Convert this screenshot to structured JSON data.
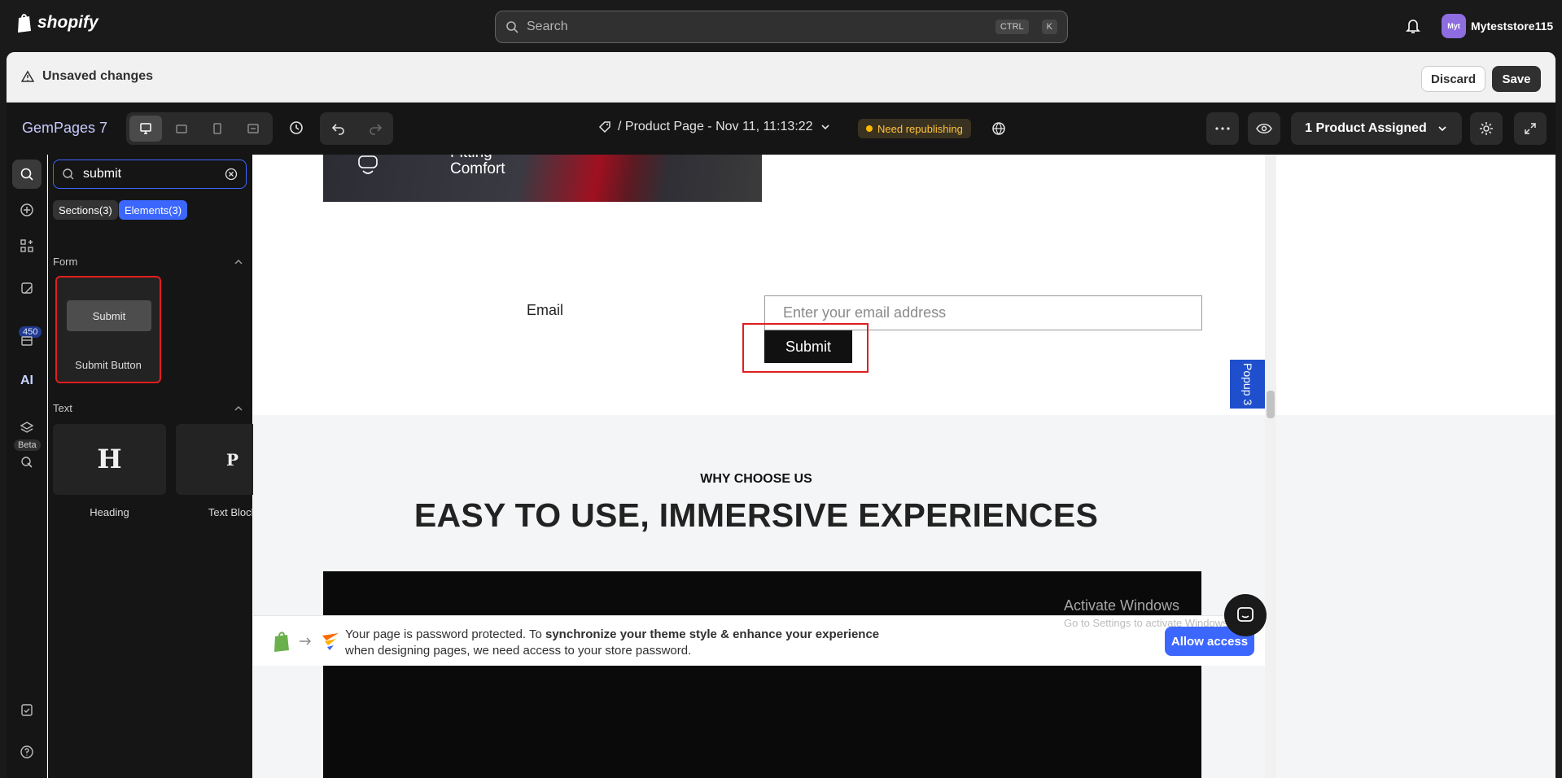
{
  "shopify": {
    "brand": "shopify",
    "search_placeholder": "Search",
    "kbd_ctrl": "CTRL",
    "kbd_k": "K",
    "avatar_initials": "Myt",
    "store_name": "Myteststore115"
  },
  "unsaved": {
    "label": "Unsaved changes",
    "discard": "Discard",
    "save": "Save"
  },
  "toolbar": {
    "brand": "GemPages 7",
    "page_title": "/ Product Page - Nov 11, 11:13:22",
    "status": "Need republishing",
    "assign": "1 Product Assigned"
  },
  "rail": {
    "count_badge": "450",
    "ai_label": "AI",
    "beta": "Beta"
  },
  "panel": {
    "search_value": "submit",
    "chip_sections": "Sections(3)",
    "chip_elements": "Elements(3)",
    "group_form": "Form",
    "submit_preview": "Submit",
    "submit_card": "Submit Button",
    "group_text": "Text",
    "heading_glyph": "H",
    "heading_card": "Heading",
    "text_glyph": "P",
    "text_card": "Text Block"
  },
  "canvas": {
    "hero_line1": "Fitting",
    "hero_line2": "Comfort",
    "email_label": "Email",
    "email_placeholder": "Enter your email address",
    "submit": "Submit",
    "why": "WHY CHOOSE US",
    "headline": "EASY TO USE, IMMERSIVE EXPERIENCES",
    "popup": "Popup 3",
    "banner_line1_a": "Your page is password protected. To ",
    "banner_line1_b": "synchronize your theme style & enhance your experience",
    "banner_line2": "when designing pages, we need access to your store password.",
    "allow": "Allow access",
    "activate_title": "Activate Windows",
    "activate_sub": "Go to Settings to activate Windows."
  }
}
